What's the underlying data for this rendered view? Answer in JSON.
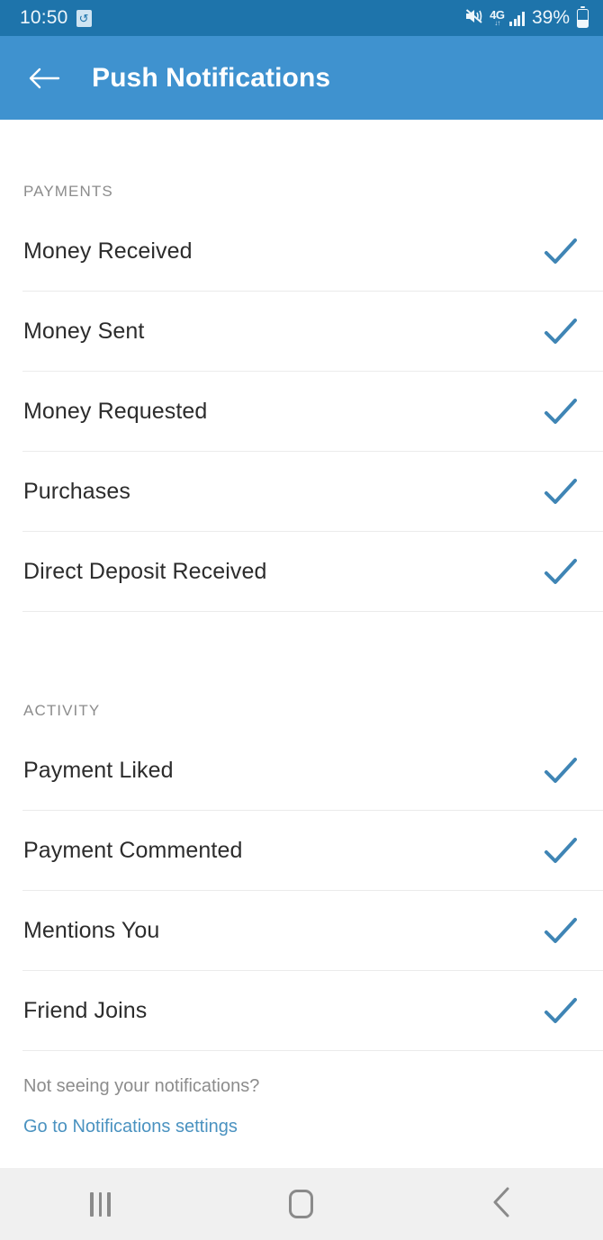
{
  "status_bar": {
    "time": "10:50",
    "alarm_icon": "alarm-icon",
    "mute_icon": "mute-vibrate-icon",
    "network_label": "4G",
    "network_arrows": "↓↑",
    "signal_icon": "signal-bars-icon",
    "battery_percent": "39%",
    "battery_icon": "battery-icon",
    "bg_color": "#1e74ab"
  },
  "app_bar": {
    "back_icon": "back-arrow-icon",
    "title": "Push Notifications",
    "bg_color": "#3f92cf",
    "text_color": "#ffffff"
  },
  "sections": [
    {
      "header": "PAYMENTS",
      "rows": [
        {
          "label": "Money Received",
          "checked": true
        },
        {
          "label": "Money Sent",
          "checked": true
        },
        {
          "label": "Money Requested",
          "checked": true
        },
        {
          "label": "Purchases",
          "checked": true
        },
        {
          "label": "Direct Deposit Received",
          "checked": true
        }
      ]
    },
    {
      "header": "ACTIVITY",
      "rows": [
        {
          "label": "Payment Liked",
          "checked": true
        },
        {
          "label": "Payment Commented",
          "checked": true
        },
        {
          "label": "Mentions You",
          "checked": true
        },
        {
          "label": "Friend Joins",
          "checked": true
        }
      ]
    }
  ],
  "footer": {
    "note": "Not seeing your notifications?",
    "link": "Go to Notifications settings",
    "link_color": "#4a92c0"
  },
  "nav_bar": {
    "recents_icon": "recents-icon",
    "home_icon": "home-icon",
    "back_icon": "back-chevron-icon",
    "bg_color": "#f0f0f0"
  },
  "theme": {
    "check_color": "#3f85b5",
    "divider_color": "#ebebeb",
    "label_color": "#2c2c2c",
    "section_header_color": "#8c8c8c"
  }
}
